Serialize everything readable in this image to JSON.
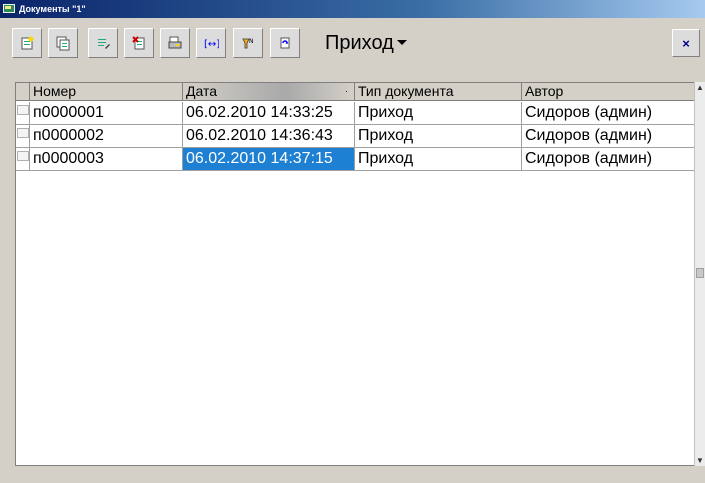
{
  "window": {
    "title": "Документы \"1\""
  },
  "toolbar": {
    "buttons": [
      {
        "name": "new-doc-button",
        "icon": "new-doc-icon"
      },
      {
        "name": "copy-doc-button",
        "icon": "copy-doc-icon"
      },
      {
        "name": "edit-doc-button",
        "icon": "edit-doc-icon"
      },
      {
        "name": "delete-doc-button",
        "icon": "delete-doc-icon"
      },
      {
        "name": "print-button",
        "icon": "print-icon"
      },
      {
        "name": "interval-button",
        "icon": "interval-icon"
      },
      {
        "name": "filter-button",
        "icon": "filter-icon"
      },
      {
        "name": "refresh-button",
        "icon": "refresh-icon"
      }
    ],
    "mode_label": "Приход",
    "close_label": "×"
  },
  "table": {
    "columns": [
      "Номер",
      "Дата",
      "Тип документа",
      "Автор"
    ],
    "sorted_column": 1,
    "rows": [
      [
        "п0000001",
        "06.02.2010 14:33:25",
        "Приход",
        "Сидоров (админ)"
      ],
      [
        "п0000002",
        "06.02.2010 14:36:43",
        "Приход",
        "Сидоров (админ)"
      ],
      [
        "п0000003",
        "06.02.2010 14:37:15",
        "Приход",
        "Сидоров (админ)"
      ]
    ],
    "selected_row": 2,
    "selected_col": 1
  },
  "colors": {
    "selection": "#1e80d2",
    "titlebar": "#0a246a"
  }
}
